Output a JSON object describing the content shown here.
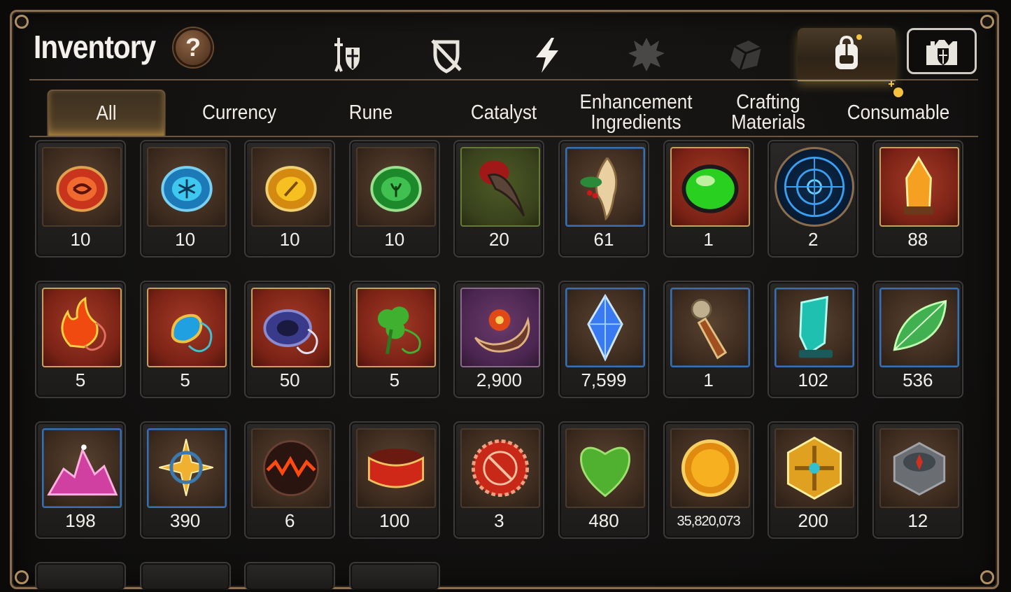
{
  "header": {
    "title": "Inventory",
    "help_label": "?"
  },
  "category_tabs": [
    {
      "name": "equipment-tab",
      "icon": "sword-shield-icon"
    },
    {
      "name": "broken-shield-tab",
      "icon": "crossed-shield-icon"
    },
    {
      "name": "skill-tab",
      "icon": "lightning-icon"
    },
    {
      "name": "beast-tab",
      "icon": "beast-icon"
    },
    {
      "name": "cube-tab",
      "icon": "cube-icon"
    },
    {
      "name": "bag-tab",
      "icon": "backpack-icon",
      "active": true
    },
    {
      "name": "guild-tab",
      "icon": "castle-shield-icon"
    }
  ],
  "sub_tabs": [
    {
      "label": "All",
      "active": true
    },
    {
      "label": "Currency"
    },
    {
      "label": "Rune"
    },
    {
      "label": "Catalyst"
    },
    {
      "label": "Enhancement\nIngredients"
    },
    {
      "label": "Crafting\nMaterials"
    },
    {
      "label": "Consumable"
    }
  ],
  "items": [
    {
      "qty": "10",
      "icon": "red-rune-stone-icon"
    },
    {
      "qty": "10",
      "icon": "blue-rune-stone-icon"
    },
    {
      "qty": "10",
      "icon": "yellow-rune-stone-icon"
    },
    {
      "qty": "10",
      "icon": "green-rune-stone-icon"
    },
    {
      "qty": "20",
      "icon": "claw-icon"
    },
    {
      "qty": "61",
      "icon": "ginseng-root-icon"
    },
    {
      "qty": "1",
      "icon": "green-gem-icon"
    },
    {
      "qty": "2",
      "icon": "blue-magic-circle-icon"
    },
    {
      "qty": "88",
      "icon": "orange-crystal-icon"
    },
    {
      "qty": "5",
      "icon": "fire-amulet-icon"
    },
    {
      "qty": "5",
      "icon": "water-amulet-icon"
    },
    {
      "qty": "50",
      "icon": "ring-amulet-icon"
    },
    {
      "qty": "5",
      "icon": "clover-amulet-icon"
    },
    {
      "qty": "2,900",
      "icon": "flower-crescent-icon"
    },
    {
      "qty": "7,599",
      "icon": "blue-diamond-icon"
    },
    {
      "qty": "1",
      "icon": "compass-pendant-icon"
    },
    {
      "qty": "102",
      "icon": "teal-crystal-icon"
    },
    {
      "qty": "536",
      "icon": "leaf-icon"
    },
    {
      "qty": "198",
      "icon": "pink-crystal-pile-icon"
    },
    {
      "qty": "390",
      "icon": "star-amulet-icon"
    },
    {
      "qty": "6",
      "icon": "lava-orb-icon"
    },
    {
      "qty": "100",
      "icon": "red-band-icon"
    },
    {
      "qty": "3",
      "icon": "red-seal-icon"
    },
    {
      "qty": "480",
      "icon": "heart-leaf-icon"
    },
    {
      "qty": "35,820,073",
      "icon": "gold-coin-icon"
    },
    {
      "qty": "200",
      "icon": "gold-emblem-icon"
    },
    {
      "qty": "12",
      "icon": "stone-compass-icon"
    }
  ]
}
